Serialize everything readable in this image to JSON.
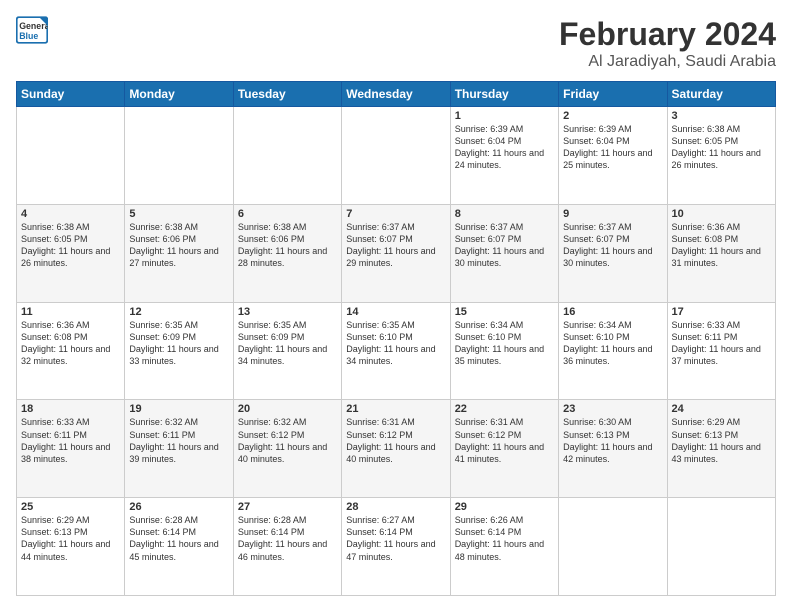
{
  "logo": {
    "line1": "General",
    "line2": "Blue"
  },
  "header": {
    "title": "February 2024",
    "subtitle": "Al Jaradiyah, Saudi Arabia"
  },
  "weekdays": [
    "Sunday",
    "Monday",
    "Tuesday",
    "Wednesday",
    "Thursday",
    "Friday",
    "Saturday"
  ],
  "weeks": [
    [
      null,
      null,
      null,
      null,
      {
        "day": 1,
        "sunrise": "6:39 AM",
        "sunset": "6:04 PM",
        "daylight": "11 hours and 24 minutes."
      },
      {
        "day": 2,
        "sunrise": "6:39 AM",
        "sunset": "6:04 PM",
        "daylight": "11 hours and 25 minutes."
      },
      {
        "day": 3,
        "sunrise": "6:38 AM",
        "sunset": "6:05 PM",
        "daylight": "11 hours and 26 minutes."
      }
    ],
    [
      {
        "day": 4,
        "sunrise": "6:38 AM",
        "sunset": "6:05 PM",
        "daylight": "11 hours and 26 minutes."
      },
      {
        "day": 5,
        "sunrise": "6:38 AM",
        "sunset": "6:06 PM",
        "daylight": "11 hours and 27 minutes."
      },
      {
        "day": 6,
        "sunrise": "6:38 AM",
        "sunset": "6:06 PM",
        "daylight": "11 hours and 28 minutes."
      },
      {
        "day": 7,
        "sunrise": "6:37 AM",
        "sunset": "6:07 PM",
        "daylight": "11 hours and 29 minutes."
      },
      {
        "day": 8,
        "sunrise": "6:37 AM",
        "sunset": "6:07 PM",
        "daylight": "11 hours and 30 minutes."
      },
      {
        "day": 9,
        "sunrise": "6:37 AM",
        "sunset": "6:07 PM",
        "daylight": "11 hours and 30 minutes."
      },
      {
        "day": 10,
        "sunrise": "6:36 AM",
        "sunset": "6:08 PM",
        "daylight": "11 hours and 31 minutes."
      }
    ],
    [
      {
        "day": 11,
        "sunrise": "6:36 AM",
        "sunset": "6:08 PM",
        "daylight": "11 hours and 32 minutes."
      },
      {
        "day": 12,
        "sunrise": "6:35 AM",
        "sunset": "6:09 PM",
        "daylight": "11 hours and 33 minutes."
      },
      {
        "day": 13,
        "sunrise": "6:35 AM",
        "sunset": "6:09 PM",
        "daylight": "11 hours and 34 minutes."
      },
      {
        "day": 14,
        "sunrise": "6:35 AM",
        "sunset": "6:10 PM",
        "daylight": "11 hours and 34 minutes."
      },
      {
        "day": 15,
        "sunrise": "6:34 AM",
        "sunset": "6:10 PM",
        "daylight": "11 hours and 35 minutes."
      },
      {
        "day": 16,
        "sunrise": "6:34 AM",
        "sunset": "6:10 PM",
        "daylight": "11 hours and 36 minutes."
      },
      {
        "day": 17,
        "sunrise": "6:33 AM",
        "sunset": "6:11 PM",
        "daylight": "11 hours and 37 minutes."
      }
    ],
    [
      {
        "day": 18,
        "sunrise": "6:33 AM",
        "sunset": "6:11 PM",
        "daylight": "11 hours and 38 minutes."
      },
      {
        "day": 19,
        "sunrise": "6:32 AM",
        "sunset": "6:11 PM",
        "daylight": "11 hours and 39 minutes."
      },
      {
        "day": 20,
        "sunrise": "6:32 AM",
        "sunset": "6:12 PM",
        "daylight": "11 hours and 40 minutes."
      },
      {
        "day": 21,
        "sunrise": "6:31 AM",
        "sunset": "6:12 PM",
        "daylight": "11 hours and 40 minutes."
      },
      {
        "day": 22,
        "sunrise": "6:31 AM",
        "sunset": "6:12 PM",
        "daylight": "11 hours and 41 minutes."
      },
      {
        "day": 23,
        "sunrise": "6:30 AM",
        "sunset": "6:13 PM",
        "daylight": "11 hours and 42 minutes."
      },
      {
        "day": 24,
        "sunrise": "6:29 AM",
        "sunset": "6:13 PM",
        "daylight": "11 hours and 43 minutes."
      }
    ],
    [
      {
        "day": 25,
        "sunrise": "6:29 AM",
        "sunset": "6:13 PM",
        "daylight": "11 hours and 44 minutes."
      },
      {
        "day": 26,
        "sunrise": "6:28 AM",
        "sunset": "6:14 PM",
        "daylight": "11 hours and 45 minutes."
      },
      {
        "day": 27,
        "sunrise": "6:28 AM",
        "sunset": "6:14 PM",
        "daylight": "11 hours and 46 minutes."
      },
      {
        "day": 28,
        "sunrise": "6:27 AM",
        "sunset": "6:14 PM",
        "daylight": "11 hours and 47 minutes."
      },
      {
        "day": 29,
        "sunrise": "6:26 AM",
        "sunset": "6:14 PM",
        "daylight": "11 hours and 48 minutes."
      },
      null,
      null
    ]
  ]
}
